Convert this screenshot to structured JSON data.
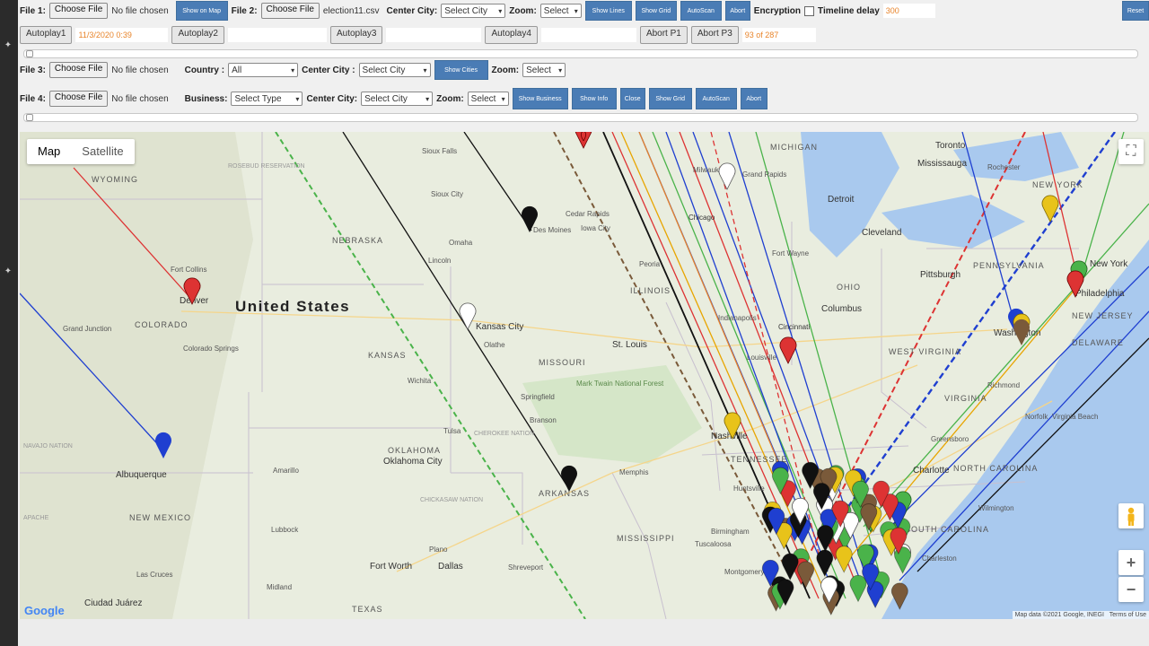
{
  "row1": {
    "file1_label": "File 1:",
    "file_button": "Choose File",
    "file1_status": "No file chosen",
    "show_on_map": "Show on Map",
    "file2_label": "File 2:",
    "file2_status": "election11.csv",
    "center_city_label": "Center City:",
    "center_city_value": "Select City",
    "zoom_label": "Zoom:",
    "zoom_value": "Select",
    "show_lines": "Show Lines",
    "show_grid": "Show Grid",
    "autoscan": "AutoScan",
    "abort": "Abort",
    "encryption_label": "Encryption",
    "timeline_label": "Timeline delay",
    "timeline_value": "300",
    "reset": "Reset"
  },
  "row2": {
    "autoplay1": "Autoplay1",
    "autoplay1_time": "11/3/2020 0:39",
    "autoplay2": "Autoplay2",
    "autoplay3": "Autoplay3",
    "autoplay4": "Autoplay4",
    "abort_p1": "Abort P1",
    "abort_p3": "Abort P3",
    "progress": "93 of 287"
  },
  "row3": {
    "file3_label": "File 3:",
    "file_button": "Choose File",
    "file3_status": "No file chosen",
    "country_label": "Country :",
    "country_value": "All",
    "center_city_label": "Center City :",
    "center_city_value": "Select City",
    "show_cities": "Show Cities",
    "zoom_label": "Zoom:",
    "zoom_value": "Select"
  },
  "row4": {
    "file4_label": "File 4:",
    "file_button": "Choose File",
    "file4_status": "No file chosen",
    "business_label": "Business:",
    "business_value": "Select Type",
    "center_city_label": "Center City:",
    "center_city_value": "Select City",
    "zoom_label": "Zoom:",
    "zoom_value": "Select",
    "show_business": "Show Business",
    "show_info": "Show Info",
    "close": "Close",
    "show_grid": "Show Grid",
    "autoscan": "AutoScan",
    "abort": "Abort"
  },
  "map": {
    "tab_map": "Map",
    "tab_satellite": "Satellite",
    "country_label": "United States",
    "attribution": "Map data ©2021 Google, INEGI",
    "terms": "Terms of Use",
    "logo": "Google",
    "zoom_in": "+",
    "zoom_out": "−",
    "places": {
      "sioux_falls": "Sioux Falls",
      "sioux_city": "Sioux City",
      "des_moines": "Des Moines",
      "cedar_rapids": "Cedar Rapids",
      "iowa_city": "Iowa City",
      "omaha": "Omaha",
      "lincoln": "Lincoln",
      "nebraska": "NEBRASKA",
      "wyoming": "WYOMING",
      "fort_collins": "Fort Collins",
      "denver": "Denver",
      "colorado": "COLORADO",
      "colorado_springs": "Colorado Springs",
      "grand_junction": "Grand Junction",
      "kansas_city": "Kansas City",
      "olathe": "Olathe",
      "kansas": "KANSAS",
      "wichita": "Wichita",
      "missouri": "MISSOURI",
      "st_louis": "St. Louis",
      "springfield": "Springfield",
      "mark_twain": "Mark Twain National Forest",
      "illinois": "ILLINOIS",
      "peoria": "Peoria",
      "chicago": "Chicago",
      "milwaukee": "Milwaukee",
      "grand_rapids": "Grand Rapids",
      "michigan": "MICHIGAN",
      "detroit": "Detroit",
      "toronto": "Toronto",
      "mississauga": "Mississauga",
      "rochester": "Rochester",
      "cleveland": "Cleveland",
      "fort_wayne": "Fort Wayne",
      "ohio": "OHIO",
      "columbus": "Columbus",
      "indianapolis": "Indianapolis",
      "cincinnati": "Cincinnati",
      "louisville": "Louisville",
      "pittsburgh": "Pittsburgh",
      "pennsylvania": "PENNSYLVANIA",
      "new_york": "New York",
      "new_york_state": "NEW YORK",
      "philadelphia": "Philadelphia",
      "new_jersey": "NEW JERSEY",
      "washington": "Washington",
      "delaware": "DELAWARE",
      "west_virginia": "WEST VIRGINIA",
      "virginia": "VIRGINIA",
      "richmond": "Richmond",
      "norfolk": "Norfolk",
      "virginia_beach": "Virginia Beach",
      "nashville": "Nashville",
      "tennessee": "TENNESSEE",
      "huntsville": "Huntsville",
      "greensboro": "Greensboro",
      "charlotte": "Charlotte",
      "north_carolina": "NORTH CAROLINA",
      "south_carolina": "SOUTH CAROLINA",
      "wilmington": "Wilmington",
      "charleston": "Charleston",
      "birmingham": "Birmingham",
      "tuscaloosa": "Tuscaloosa",
      "montgomery": "Montgomery",
      "mississippi": "MISSISSIPPI",
      "memphis": "Memphis",
      "arkansas": "ARKANSAS",
      "oklahoma": "OKLAHOMA",
      "oklahoma_city": "Oklahoma City",
      "tulsa": "Tulsa",
      "cherokee_nation": "CHEROKEE NATION",
      "chickasaw_nation": "CHICKASAW NATION",
      "amarillo": "Amarillo",
      "lubbock": "Lubbock",
      "plano": "Plano",
      "fort_worth": "Fort Worth",
      "dallas": "Dallas",
      "shreveport": "Shreveport",
      "midland": "Midland",
      "texas": "TEXAS",
      "albuquerque": "Albuquerque",
      "new_mexico": "NEW MEXICO",
      "las_cruces": "Las Cruces",
      "ciudad_juarez": "Ciudad Juárez",
      "navajo_nation": "NAVAJO NATION",
      "apache": "APACHE",
      "bransom": "Branson",
      "rosebud": "ROSEBUD RESERVATION"
    }
  }
}
